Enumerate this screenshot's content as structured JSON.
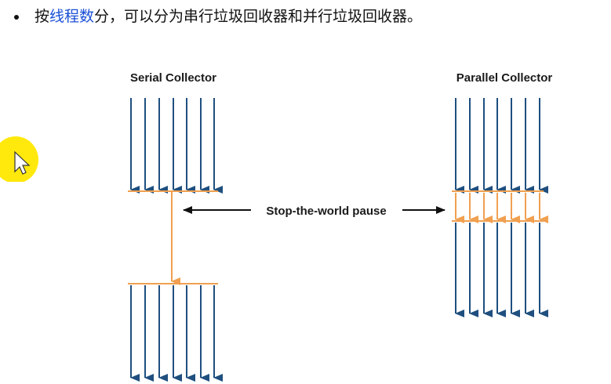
{
  "header": {
    "bullet_prefix": "按",
    "highlight": "线程数",
    "bullet_suffix": "分，可以分为串行垃圾回收器和并行垃圾回收器。"
  },
  "diagram": {
    "serial_title": "Serial Collector",
    "parallel_title": "Parallel Collector",
    "pause_label": "Stop-the-world pause",
    "colors": {
      "thread_arrow": "#1f4f7f",
      "gc_arrow": "#f0a050",
      "cursor": "#ffe800"
    },
    "icons": [
      "cursor-highlight-icon",
      "mouse-pointer-icon"
    ]
  }
}
